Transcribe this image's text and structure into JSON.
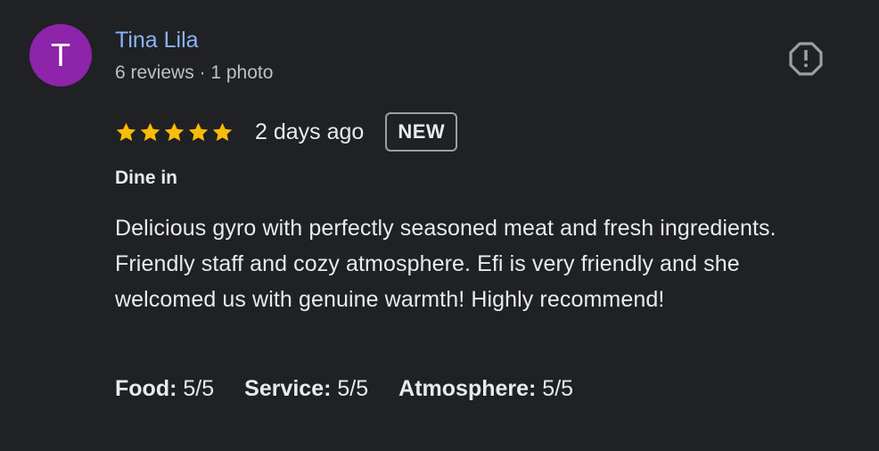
{
  "reviewer": {
    "initial": "T",
    "name": "Tina Lila",
    "meta": "6 reviews · 1 photo",
    "avatar_color": "#8e24aa",
    "name_color": "#8ab4f8"
  },
  "report": {
    "icon": "report-octagon-icon"
  },
  "rating": {
    "stars": 5,
    "max_stars": 5,
    "star_color": "#fbbc04",
    "date": "2 days ago",
    "badge": "NEW"
  },
  "service_type": "Dine in",
  "review_text": "Delicious gyro with perfectly seasoned meat and fresh ingredients. Friendly staff and cozy atmosphere. Efi is very friendly and she welcomed us with genuine warmth! Highly recommend!",
  "aspects": [
    {
      "label": "Food:",
      "value": "5/5"
    },
    {
      "label": "Service:",
      "value": "5/5"
    },
    {
      "label": "Atmosphere:",
      "value": "5/5"
    }
  ]
}
